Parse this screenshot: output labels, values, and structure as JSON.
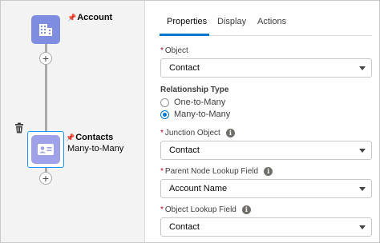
{
  "canvas": {
    "nodes": [
      {
        "name": "Account",
        "subtitle": ""
      },
      {
        "name": "Contacts",
        "subtitle": "Many-to-Many"
      }
    ],
    "add_label": "+",
    "pin_glyph": "📌"
  },
  "panel": {
    "tabs": [
      "Properties",
      "Display",
      "Actions"
    ],
    "active_tab": "Properties",
    "fields": {
      "object": {
        "label": "Object",
        "value": "Contact",
        "required": true
      },
      "relationship_type": {
        "label": "Relationship Type",
        "options": [
          "One-to-Many",
          "Many-to-Many"
        ],
        "selected": "Many-to-Many"
      },
      "junction_object": {
        "label": "Junction Object",
        "value": "Contact",
        "required": true
      },
      "parent_lookup": {
        "label": "Parent Node Lookup Field",
        "value": "Account Name",
        "required": true
      },
      "object_lookup": {
        "label": "Object Lookup Field",
        "value": "Contact",
        "required": true
      }
    },
    "required_marker": "*",
    "info_glyph": "i"
  },
  "colors": {
    "accent": "#0176d3",
    "node_icon": "#7f8de1",
    "required": "#ba0517"
  }
}
